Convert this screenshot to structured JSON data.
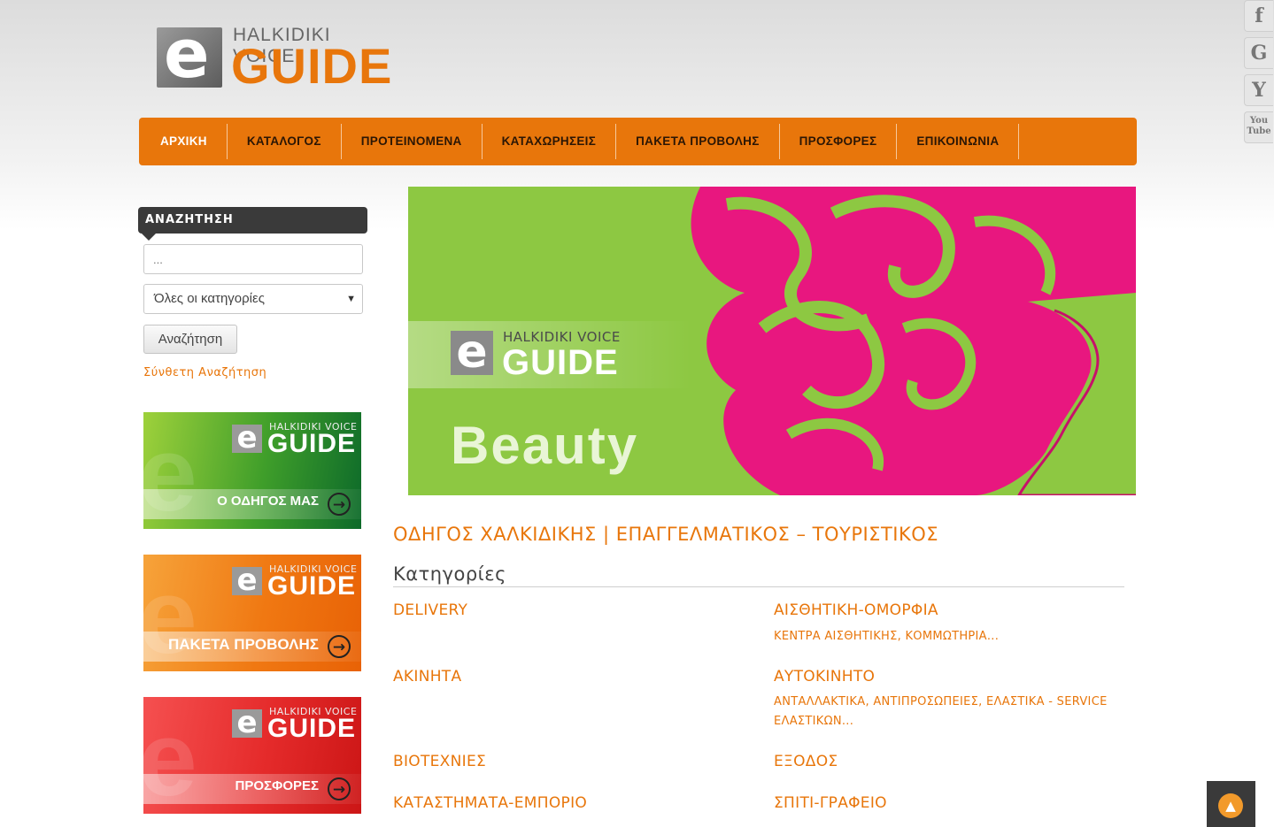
{
  "logo": {
    "voice": "HALKIDIKI VOICE",
    "guide": "GUIDE",
    "e": "e"
  },
  "nav": {
    "items": [
      "ΑΡΧΙΚΗ",
      "ΚΑΤΑΛΟΓΟΣ",
      "ΠΡΟΤΕΙΝΟΜΕΝΑ",
      "ΚΑΤΑΧΩΡΗΣΕΙΣ",
      "ΠΑΚΕΤΑ ΠΡΟΒΟΛΗΣ",
      "ΠΡΟΣΦΟΡΕΣ",
      "ΕΠΙΚΟΙΝΩΝΙΑ"
    ]
  },
  "social": {
    "facebook": "f",
    "google": "G",
    "other": "Y",
    "youtube_top": "You",
    "youtube_bottom": "Tube"
  },
  "search": {
    "heading": "ΑΝΑΖΗΤΗΣΗ",
    "placeholder": "...",
    "category_selected": "Όλες οι κατηγορίες",
    "button": "Αναζήτηση",
    "advanced_link": "Σύνθετη Αναζήτηση"
  },
  "banners": [
    {
      "voice": "HALKIDIKI VOICE",
      "guide": "GUIDE",
      "label": "Ο ΟΔΗΓΟΣ ΜΑΣ"
    },
    {
      "voice": "HALKIDIKI VOICE",
      "guide": "GUIDE",
      "label": "ΠΑΚΕΤΑ ΠΡΟΒΟΛΗΣ"
    },
    {
      "voice": "HALKIDIKI VOICE",
      "guide": "GUIDE",
      "label": "ΠΡΟΣΦΟΡΕΣ"
    }
  ],
  "hero": {
    "voice": "HALKIDIKI VOICE",
    "guide": "GUIDE",
    "title": "Beauty"
  },
  "main": {
    "title": "ΟΔΗΓΟΣ ΧΑΛΚΙΔΙΚΗΣ | ΕΠΑΓΓΕΛΜΑΤΙΚΟΣ – ΤΟΥΡΙΣΤΙΚΟΣ",
    "categories_heading": "Κατηγορίες",
    "categories": [
      {
        "name": "DELIVERY",
        "sub": ""
      },
      {
        "name": "ΑΙΣΘΗΤΙΚΗ-ΟΜΟΡΦΙΑ",
        "sub": "ΚΕΝΤΡΑ ΑΙΣΘΗΤΙΚΗΣ, ΚΟΜΜΩΤΗΡΙΑ..."
      },
      {
        "name": "ΑΚΙΝΗΤΑ",
        "sub": ""
      },
      {
        "name": "ΑΥΤΟΚΙΝΗΤΟ",
        "sub": "ΑΝΤΑΛΛΑΚΤΙΚΑ, ΑΝΤΙΠΡΟΣΩΠΕΙΕΣ, ΕΛΑΣΤΙΚΑ - SERVICE ΕΛΑΣΤΙΚΩΝ..."
      },
      {
        "name": "ΒΙΟΤΕΧΝΙΕΣ",
        "sub": ""
      },
      {
        "name": "ΕΞΟΔΟΣ",
        "sub": ""
      },
      {
        "name": "ΚΑΤΑΣΤΗΜΑΤΑ-ΕΜΠΟΡΙΟ",
        "sub": ""
      },
      {
        "name": "ΣΠΙΤΙ-ΓΡΑΦΕΙΟ",
        "sub": ""
      }
    ]
  },
  "colors": {
    "accent": "#e8760b",
    "dark": "#3a3a3a",
    "hero_green": "#8dc842",
    "hero_pink": "#e8177f"
  }
}
